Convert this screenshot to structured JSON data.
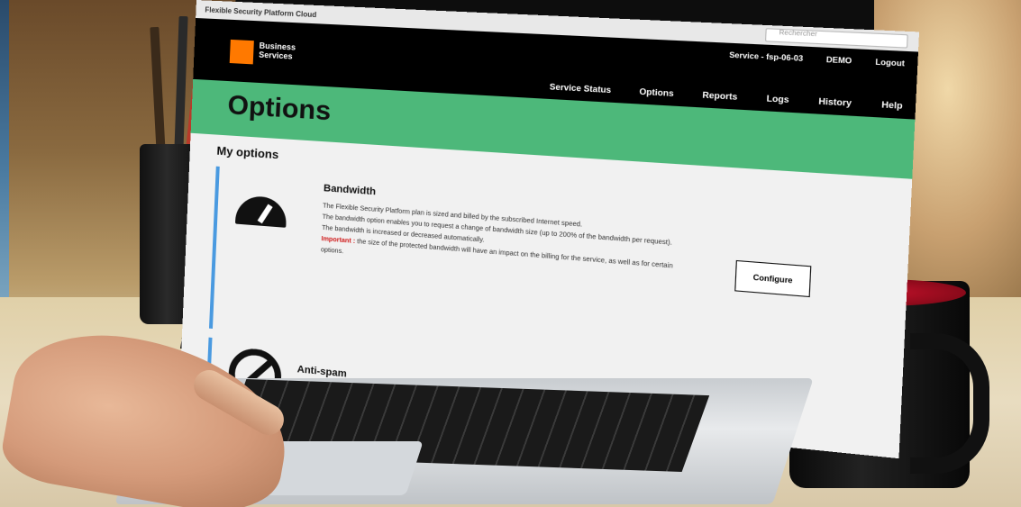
{
  "browser": {
    "tab_title": "Flexible Security Platform Cloud",
    "search_placeholder": "Rechercher"
  },
  "header": {
    "service_label": "Service - fsp-06-03",
    "account": "DEMO",
    "logout": "Logout",
    "logo_line1": "Business",
    "logo_line2": "Services",
    "nav": [
      "Service Status",
      "Options",
      "Reports",
      "Logs",
      "History",
      "Help"
    ]
  },
  "page": {
    "title": "Options",
    "section": "My options"
  },
  "options": [
    {
      "title": "Bandwidth",
      "lines": [
        "The Flexible Security Platform plan is sized and billed by the subscribed Internet speed.",
        "The bandwidth option enables you to request a change of bandwidth size (up to 200% of the bandwidth per request).",
        "The bandwidth is increased or decreased automatically."
      ],
      "important_label": "Important :",
      "important_text": "the size of the protected bandwidth will have an impact on the billing for the service, as well as for certain options.",
      "button": "Configure",
      "icon": "gauge-icon"
    },
    {
      "title": "Anti-spam",
      "icon": "no-spam-icon"
    }
  ],
  "colors": {
    "brand_orange": "#ff7900",
    "title_band": "#4db87a",
    "accent_blue": "#4a9ae0",
    "warning_red": "#d01c1c"
  }
}
